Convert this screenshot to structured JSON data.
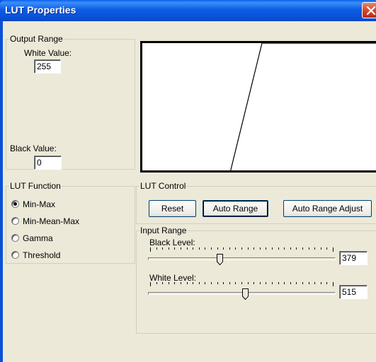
{
  "window": {
    "title": "LUT Properties"
  },
  "output_range": {
    "title": "Output Range",
    "white_label": "White Value:",
    "white_value": "255",
    "black_label": "Black Value:",
    "black_value": "0"
  },
  "lut_function": {
    "title": "LUT Function",
    "options": [
      "Min-Max",
      "Min-Mean-Max",
      "Gamma",
      "Threshold"
    ],
    "selected": "Min-Max"
  },
  "lut_control": {
    "title": "LUT Control",
    "reset_label": "Reset",
    "auto_range_label": "Auto Range",
    "auto_range_adjust_label": "Auto Range Adjust"
  },
  "input_range": {
    "title": "Input Range",
    "black_label": "Black Level:",
    "black_value": "379",
    "black_slider_fraction": 0.38,
    "white_label": "White Level:",
    "white_value": "515",
    "white_slider_fraction": 0.52
  },
  "colors": {
    "dialog_face": "#ece9d8",
    "titlebar_blue": "#0a52d8",
    "close_red": "#d2442c"
  },
  "icons": {
    "close": "close-icon",
    "radio": "radio-icon",
    "slider_thumb": "slider-thumb"
  }
}
